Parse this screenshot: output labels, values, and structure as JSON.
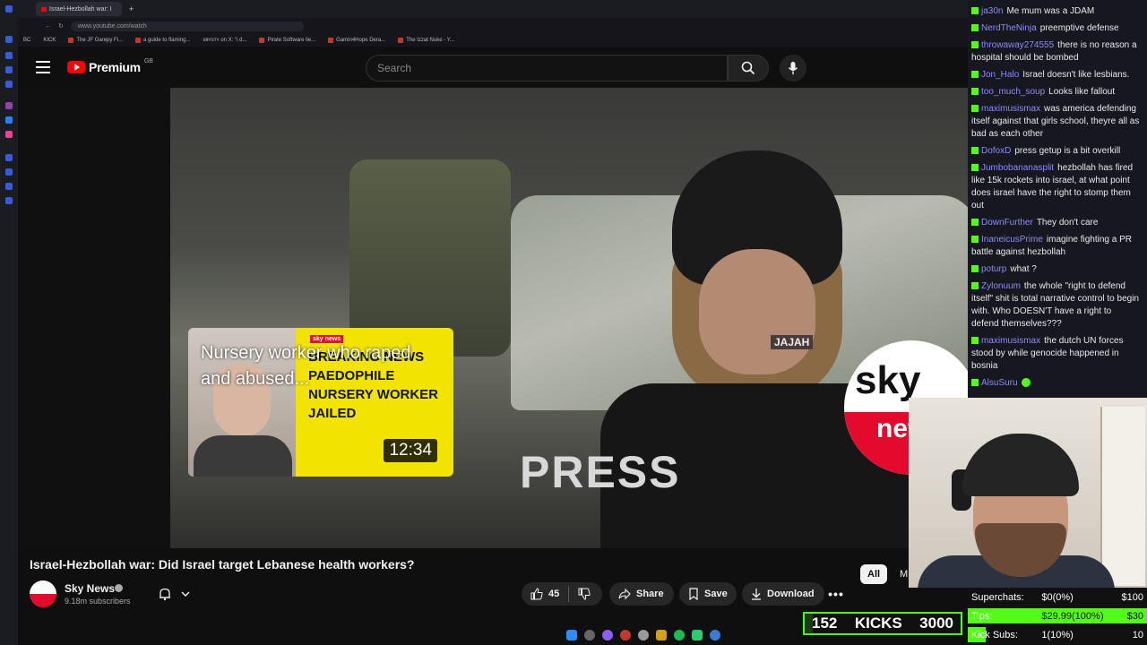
{
  "browser": {
    "tab_title": "Israel-Hezbollah war: I",
    "url": "www.youtube.com/watch",
    "bookmarks": [
      "BC",
      "KICK",
      "The JF Garepy Fi...",
      "a guide to flaming...",
      "xʀʏsтʏ on X: \"i d...",
      "Pirate Software lie...",
      "Gamin4Hope Dera...",
      "The Izzat Nuke - Y..."
    ]
  },
  "youtube": {
    "logo_text": "Premium",
    "region": "GB",
    "search_placeholder": "Search"
  },
  "video": {
    "press_text": "PRESS",
    "sky_logo": "sky",
    "sky_news": "news",
    "sign_text": "JAJAH",
    "endcard": {
      "overlay_title": "Nursery worker who raped and abused...",
      "badge": "sky news",
      "headline": "BREAKING NEWS PAEDOPHILE NURSERY WORKER JAILED",
      "duration": "12:34"
    }
  },
  "info": {
    "title": "Israel-Hezbollah war: Did Israel target Lebanese health workers?",
    "channel": "Sky News",
    "subscribers": "9.18m subscribers",
    "likes": "45",
    "share": "Share",
    "save": "Save",
    "download": "Download",
    "chip_all": "All",
    "chip_m": "M"
  },
  "chat": [
    {
      "user": "ja30n",
      "color": "#8b8bff",
      "text": "Me mum was a JDAM"
    },
    {
      "user": "NerdTheNinja",
      "color": "#8b8bff",
      "text": "preemptive defense"
    },
    {
      "user": "throwaway274555",
      "color": "#8b8bff",
      "text": "there is no reason a hospital should be bombed"
    },
    {
      "user": "Jon_Halo",
      "color": "#8b8bff",
      "text": "Israel doesn't like lesbians."
    },
    {
      "user": "too_much_soup",
      "color": "#8b8bff",
      "text": "Looks like fallout"
    },
    {
      "user": "maximusismax",
      "color": "#8b8bff",
      "text": "was america defending itself against that girls school, theyre all as bad as each other"
    },
    {
      "user": "DofoxD",
      "color": "#8b8bff",
      "text": "press getup is a bit overkill"
    },
    {
      "user": "Jumbobananasplit",
      "color": "#8b8bff",
      "text": "hezbollah has fired like 15k rockets into israel, at what point does israel have the right to stomp them out"
    },
    {
      "user": "DownFurther",
      "color": "#8b8bff",
      "text": "They don't care"
    },
    {
      "user": "InaneicusPrime",
      "color": "#8b8bff",
      "text": "imagine fighting a PR battle against hezbollah"
    },
    {
      "user": "poturp",
      "color": "#8b8bff",
      "text": "what ?"
    },
    {
      "user": "Zylonuum",
      "color": "#8b8bff",
      "text": "the whole \"right to defend itself\" shit is total narrative control to begin with. Who DOESN'T have a right to defend themselves???"
    },
    {
      "user": "maximusismax",
      "color": "#8b8bff",
      "text": "the dutch UN forces stood by while genocide happened in bosnia"
    },
    {
      "user": "AlsuSuru",
      "color": "#8b8bff",
      "text": ""
    }
  ],
  "goals": {
    "kicks_current": "152",
    "kicks_label": "KICKS",
    "kicks_goal": "3000",
    "kicks_progress": 0.05,
    "superchats": {
      "label": "Superchats:",
      "value": "$0(0%)",
      "goal": "$100",
      "progress": 0
    },
    "tips": {
      "label": "Tips:",
      "value": "$29.99(100%)",
      "goal": "$30",
      "progress": 1.0
    },
    "kick_subs": {
      "label": "Kick Subs:",
      "value": "1(10%)",
      "goal": "10",
      "progress": 0.1
    }
  },
  "colors": {
    "accent_green": "#53fc18",
    "youtube_red": "#ff0000",
    "sky_red": "#e40a2d"
  }
}
